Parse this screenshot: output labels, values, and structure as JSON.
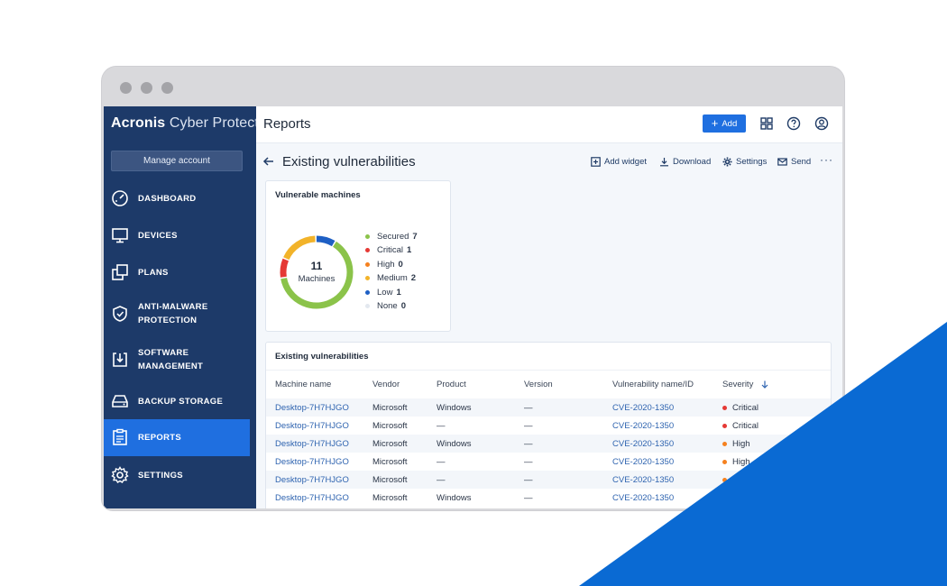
{
  "colors": {
    "sidebar": "#1d3a69",
    "accent": "#1f6fe0",
    "corner_blue": "#0a6ad3",
    "link": "#2f64b0",
    "secured": "#8bc34a",
    "critical": "#e53935",
    "high": "#f5811f",
    "medium": "#f2b32a",
    "low": "#1e5fc4",
    "none": "#e3e8ef"
  },
  "sidebar": {
    "brand_bold": "Acronis",
    "brand_light": "Cyber Protect",
    "manage_account": "Manage account",
    "items": [
      {
        "label": "DASHBOARD",
        "icon": "dashboard-gauge-icon"
      },
      {
        "label": "DEVICES",
        "icon": "monitor-icon"
      },
      {
        "label": "PLANS",
        "icon": "plans-squares-icon"
      },
      {
        "label": "ANTI-MALWARE",
        "label2": "PROTECTION",
        "icon": "shield-icon"
      },
      {
        "label": "SOFTWARE",
        "label2": "MANAGEMENT",
        "icon": "software-download-icon"
      },
      {
        "label": "BACKUP STORAGE",
        "icon": "hard-drive-icon"
      },
      {
        "label": "REPORTS",
        "icon": "clipboard-report-icon",
        "active": true
      },
      {
        "label": "SETTINGS",
        "icon": "gear-icon"
      }
    ]
  },
  "topbar": {
    "title": "Reports",
    "add_label": "Add"
  },
  "report": {
    "title": "Existing vulnerabilities",
    "actions": [
      "Add widget",
      "Download",
      "Settings",
      "Send"
    ]
  },
  "machines_card": {
    "title": "Vulnerable machines",
    "total": "11",
    "total_label": "Machines",
    "legend": [
      {
        "name": "Secured",
        "count": "7",
        "key": "secured"
      },
      {
        "name": "Critical",
        "count": "1",
        "key": "critical"
      },
      {
        "name": "High",
        "count": "0",
        "key": "high"
      },
      {
        "name": "Medium",
        "count": "2",
        "key": "medium"
      },
      {
        "name": "Low",
        "count": "1",
        "key": "low"
      },
      {
        "name": "None",
        "count": "0",
        "key": "none"
      }
    ]
  },
  "table": {
    "title": "Existing vulnerabilities",
    "columns": [
      "Machine name",
      "Vendor",
      "Product",
      "Version",
      "Vulnerability name/ID",
      "Severity"
    ],
    "rows": [
      {
        "machine": "Desktop-7H7HJGO",
        "vendor": "Microsoft",
        "product": "Windows",
        "version": "—",
        "vuln": "CVE-2020-1350",
        "severity": "Critical",
        "sev_key": "critical"
      },
      {
        "machine": "Desktop-7H7HJGO",
        "vendor": "Microsoft",
        "product": "—",
        "version": "—",
        "vuln": "CVE-2020-1350",
        "severity": "Critical",
        "sev_key": "critical"
      },
      {
        "machine": "Desktop-7H7HJGO",
        "vendor": "Microsoft",
        "product": "Windows",
        "version": "—",
        "vuln": "CVE-2020-1350",
        "severity": "High",
        "sev_key": "high"
      },
      {
        "machine": "Desktop-7H7HJGO",
        "vendor": "Microsoft",
        "product": "—",
        "version": "—",
        "vuln": "CVE-2020-1350",
        "severity": "High",
        "sev_key": "high"
      },
      {
        "machine": "Desktop-7H7HJGO",
        "vendor": "Microsoft",
        "product": "—",
        "version": "—",
        "vuln": "CVE-2020-1350",
        "severity": "",
        "sev_key": "high"
      },
      {
        "machine": "Desktop-7H7HJGO",
        "vendor": "Microsoft",
        "product": "Windows",
        "version": "—",
        "vuln": "CVE-2020-1350",
        "severity": "",
        "sev_key": "high"
      }
    ]
  }
}
